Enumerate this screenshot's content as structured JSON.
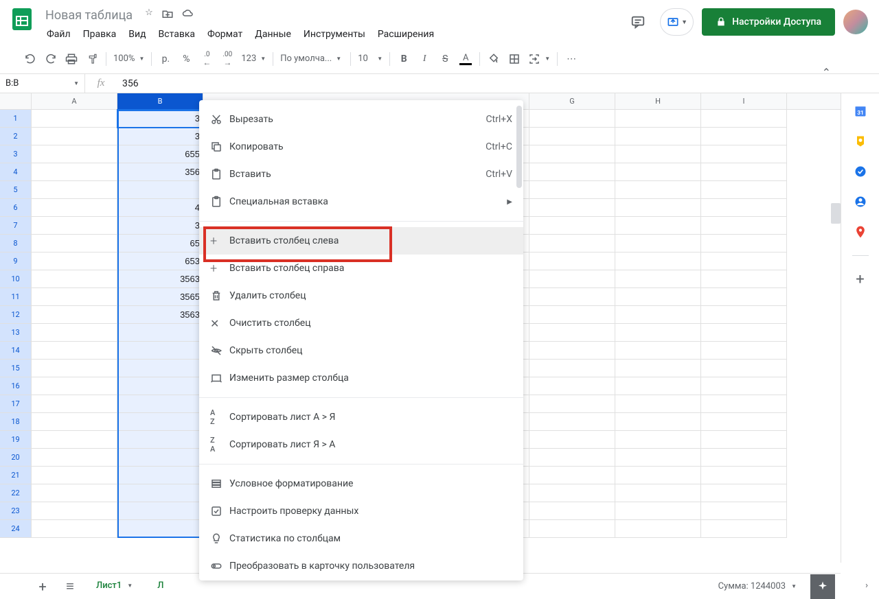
{
  "doc_title": "Новая таблица",
  "menu": [
    "Файл",
    "Правка",
    "Вид",
    "Вставка",
    "Формат",
    "Данные",
    "Инструменты",
    "Расширения"
  ],
  "share_button": "Настройки Доступа",
  "toolbar": {
    "zoom": "100%",
    "currency": "р.",
    "percent": "%",
    "decimal_dec": ".0",
    "decimal_inc": ".00",
    "format_123": "123",
    "font": "По умолча...",
    "font_size": "10"
  },
  "name_box": "B:B",
  "formula_value": "356",
  "columns": [
    "A",
    "B",
    "G",
    "H",
    "I"
  ],
  "selected_column": "B",
  "rows": [
    {
      "n": 1,
      "b": "3"
    },
    {
      "n": 2,
      "b": "3"
    },
    {
      "n": 3,
      "b": "655"
    },
    {
      "n": 4,
      "b": "356"
    },
    {
      "n": 5,
      "b": ""
    },
    {
      "n": 6,
      "b": "4"
    },
    {
      "n": 7,
      "b": "3"
    },
    {
      "n": 8,
      "b": "65"
    },
    {
      "n": 9,
      "b": "653"
    },
    {
      "n": 10,
      "b": "3563"
    },
    {
      "n": 11,
      "b": "3565"
    },
    {
      "n": 12,
      "b": "3563"
    },
    {
      "n": 13,
      "b": ""
    },
    {
      "n": 14,
      "b": ""
    },
    {
      "n": 15,
      "b": ""
    },
    {
      "n": 16,
      "b": ""
    },
    {
      "n": 17,
      "b": ""
    },
    {
      "n": 18,
      "b": ""
    },
    {
      "n": 19,
      "b": ""
    },
    {
      "n": 20,
      "b": ""
    },
    {
      "n": 21,
      "b": ""
    },
    {
      "n": 22,
      "b": ""
    },
    {
      "n": 23,
      "b": ""
    },
    {
      "n": 24,
      "b": ""
    }
  ],
  "context_menu": {
    "items": [
      {
        "icon": "cut",
        "label": "Вырезать",
        "shortcut": "Ctrl+X"
      },
      {
        "icon": "copy",
        "label": "Копировать",
        "shortcut": "Ctrl+C"
      },
      {
        "icon": "paste",
        "label": "Вставить",
        "shortcut": "Ctrl+V"
      },
      {
        "icon": "paste",
        "label": "Специальная вставка",
        "submenu": true
      },
      {
        "sep": true
      },
      {
        "icon": "plus",
        "label": "Вставить столбец слева",
        "highlighted": true
      },
      {
        "icon": "plus",
        "label": "Вставить столбец справа"
      },
      {
        "icon": "trash",
        "label": "Удалить столбец"
      },
      {
        "icon": "close",
        "label": "Очистить столбец"
      },
      {
        "icon": "eye-off",
        "label": "Скрыть столбец"
      },
      {
        "icon": "resize",
        "label": "Изменить размер столбца"
      },
      {
        "sep": true
      },
      {
        "icon": "sort-az",
        "label": "Сортировать лист А > Я"
      },
      {
        "icon": "sort-za",
        "label": "Сортировать лист Я > А"
      },
      {
        "sep": true
      },
      {
        "icon": "cond-format",
        "label": "Условное форматирование"
      },
      {
        "icon": "validate",
        "label": "Настроить проверку данных"
      },
      {
        "icon": "bulb",
        "label": "Статистика по столбцам"
      },
      {
        "icon": "chip",
        "label": "Преобразовать в карточку пользователя"
      }
    ]
  },
  "sheets": [
    {
      "name": "Лист1",
      "active": true
    },
    {
      "name": "Л"
    }
  ],
  "summary": "Сумма: 1244003"
}
